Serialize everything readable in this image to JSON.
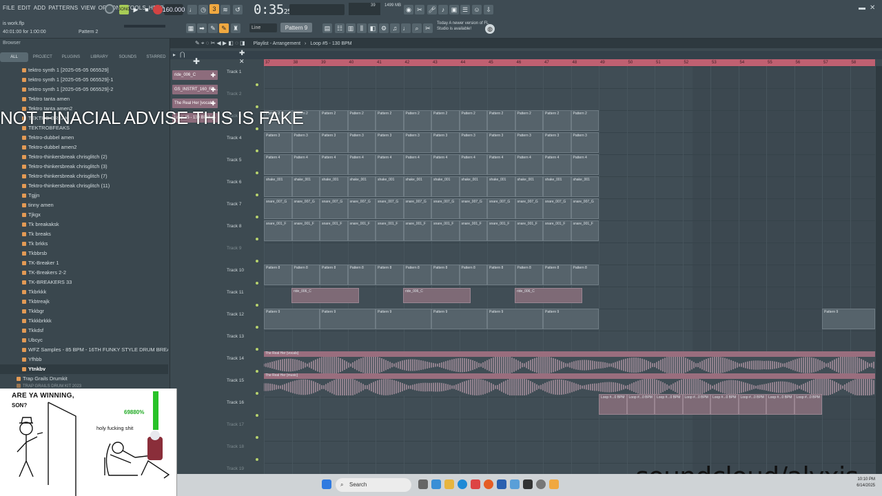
{
  "topbar": {
    "menu": [
      "FILE",
      "EDIT",
      "ADD",
      "PATTERNS",
      "VIEW",
      "OPTIONS",
      "TOOLS",
      "HELP"
    ],
    "bpm": "160.000",
    "time_main": "0:35",
    "time_small": "25",
    "mem": "1499 MB",
    "cpu": "39",
    "project_file": "is work.flp",
    "position_hint": "40:01:00 for 1:00:00",
    "pattern_small": "Pattern 2",
    "line_mode": "Line",
    "pattern_selector": "Pattern 9",
    "update_notice": "Today  A newer version of FL Studio is available!"
  },
  "browser": {
    "title": "Browser",
    "tabs": [
      "ALL",
      "PROJECT",
      "PLUGINS",
      "LIBRARY",
      "SOUNDS",
      "STARRED"
    ],
    "items": [
      "tektro synth 1 [2025-05-05 065529]",
      "tektro synth 1 [2025-05-05 065529]-1",
      "tektro synth 1 [2025-05-05 065529]-2",
      "Tektro tanta amen",
      "Tektro tanta amen2",
      "TEKTRO-BREAK",
      "TEKTROBFEAKS",
      "Tektro-dubbel amen",
      "Tektro-dubbel amen2",
      "Tektro-thinkersbreak chrisglitch (2)",
      "Tektro-thinkersbreak chrisglitch (3)",
      "Tektro-thinkersbreak chrisglitch (7)",
      "Tektro-thinkersbreak chrisglitch (11)",
      "Tgjjn",
      "tinny amen",
      "Tjkgx",
      "Tk breakaksk",
      "Tk breaks",
      "Tk brkks",
      "Tkbbrsb",
      "TK-Breaker 1",
      "TK-Breakers 2-2",
      "TK-BREAKERS 33",
      "Tkbrkkk",
      "Tkbtreajk",
      "Tkkbgr",
      "Tkkkbrkkk",
      "Tkkdsf",
      "Ubcyc",
      "WFZ Samples - 85 BPM - 16TH FUNKY STYLE DRUM BREAK [2025-06-03 031701]",
      "Yfhbb",
      "Ytnkbv"
    ],
    "group": "Trap Grails Drumkit",
    "group_sub": "TRAP GRAILS DRUM KIT 2023"
  },
  "playlist": {
    "title": "Playlist - Arrangement",
    "loop": "Loop #5 - 130 BPM",
    "ruler": [
      "37",
      "38",
      "39",
      "40",
      "41",
      "42",
      "43",
      "44",
      "45",
      "46",
      "47",
      "48",
      "49",
      "50",
      "51",
      "52",
      "53",
      "54",
      "55",
      "56",
      "57",
      "58"
    ],
    "picker": [
      "ride_006_C",
      "GS_INSTRT_160_FR...",
      "The Real Her [vocals]",
      "Loop #5 - 130 BPM"
    ],
    "tracks": [
      "Track 1",
      "Track 2",
      "Track 3",
      "Track 4",
      "Track 5",
      "Track 6",
      "Track 7",
      "Track 8",
      "Track 9",
      "Track 10",
      "Track 11",
      "Track 12",
      "Track 13",
      "Track 14",
      "Track 15",
      "Track 16",
      "Track 17",
      "Track 18",
      "Track 19"
    ],
    "clip_labels": {
      "t3": "Pattern 2",
      "t4": "Pattern 3",
      "t5": "Pattern 4",
      "t6": "shake_001",
      "t7": "snare_007_G",
      "t8": "snare_001_F",
      "t10": "Pattern 8",
      "t11": "ride_006_C",
      "t12": "Pattern 9",
      "t14": "The Real Her [vocals]",
      "t15": "The Real Her [music]",
      "t16": "Loop #...0 BPM"
    }
  },
  "overlay": {
    "banner": "NOT FINACIAL ADVISE THIS IS FAKE",
    "watermark": "soundcloud/alyxis"
  },
  "meme": {
    "line1": "ARE YA WINNING,",
    "line2": "SON?",
    "exclaim": "holy fucking shit",
    "percent": "69880%"
  },
  "taskbar": {
    "search": "Search",
    "time": "10:10 PM",
    "date": "6/14/2025"
  }
}
